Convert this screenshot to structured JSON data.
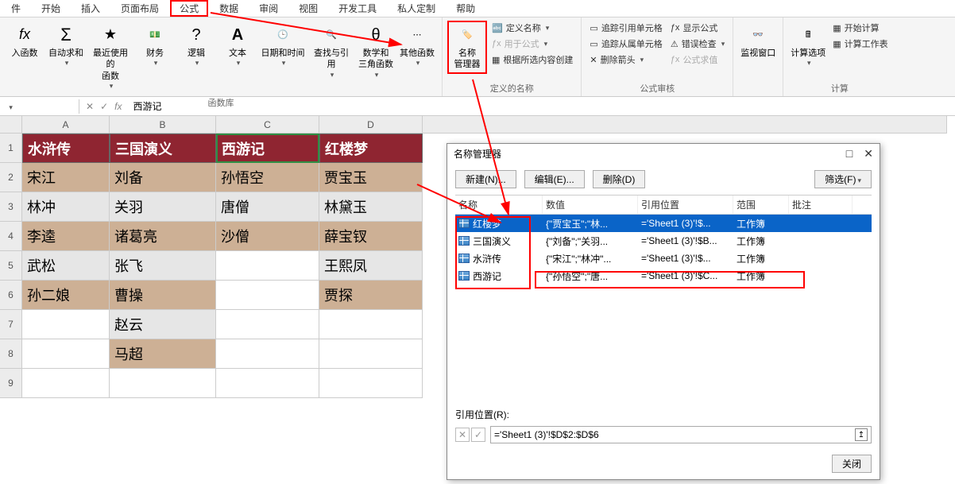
{
  "ribbon": {
    "tabs": [
      "件",
      "开始",
      "插入",
      "页面布局",
      "公式",
      "数据",
      "审阅",
      "视图",
      "开发工具",
      "私人定制",
      "帮助"
    ],
    "active_tab_index": 4,
    "group1": {
      "fx_label": "入函数",
      "autosum": "自动求和",
      "recent": "最近使用的\n函数",
      "financial": "财务",
      "logical": "逻辑",
      "text": "文本",
      "datetime": "日期和时间",
      "lookup": "查找与引用",
      "math": "数学和\n三角函数",
      "more": "其他函数",
      "label": "函数库"
    },
    "group2": {
      "name_mgr": "名称\n管理器",
      "define_name": "定义名称",
      "use_in_formula": "用于公式",
      "create_from_sel": "根据所选内容创建",
      "label": "定义的名称"
    },
    "group3": {
      "trace_prec": "追踪引用单元格",
      "trace_dep": "追踪从属单元格",
      "remove_arrows": "删除箭头",
      "show_formulas": "显示公式",
      "error_check": "错误检查",
      "eval_formula": "公式求值",
      "label": "公式审核"
    },
    "group4": {
      "watch": "监视窗口"
    },
    "group5": {
      "calc_opts": "计算选项",
      "calc_now": "开始计算",
      "calc_sheet": "计算工作表",
      "label": "计算"
    }
  },
  "formula_bar": {
    "name_box": "",
    "fx_value": "西游记"
  },
  "sheet": {
    "col_headers": [
      "A",
      "B",
      "C",
      "D"
    ],
    "row_headers": [
      "1",
      "2",
      "3",
      "4",
      "5",
      "6",
      "7",
      "8",
      "9"
    ],
    "headers": [
      "水浒传",
      "三国演义",
      "西游记",
      "红楼梦"
    ],
    "cols": {
      "A": [
        "宋江",
        "林冲",
        "李逵",
        "武松",
        "孙二娘"
      ],
      "B": [
        "刘备",
        "关羽",
        "诸葛亮",
        "张飞",
        "曹操",
        "赵云",
        "马超"
      ],
      "C": [
        "孙悟空",
        "唐僧",
        "沙僧"
      ],
      "D": [
        "贾宝玉",
        "林黛玉",
        "薛宝钗",
        "王熙凤",
        "贾探"
      ]
    }
  },
  "name_manager": {
    "title": "名称管理器",
    "new_btn": "新建(N)...",
    "edit_btn": "编辑(E)...",
    "delete_btn": "删除(D)",
    "filter_btn": "筛选(F)",
    "col_name": "名称",
    "col_value": "数值",
    "col_ref": "引用位置",
    "col_scope": "范围",
    "col_note": "批注",
    "rows": [
      {
        "name": "红楼梦",
        "value": "{\"贾宝玉\";\"林...",
        "ref": "='Sheet1 (3)'!$...",
        "scope": "工作簿"
      },
      {
        "name": "三国演义",
        "value": "{\"刘备\";\"关羽...",
        "ref": "='Sheet1 (3)'!$B...",
        "scope": "工作簿"
      },
      {
        "name": "水浒传",
        "value": "{\"宋江\";\"林冲\"...",
        "ref": "='Sheet1 (3)'!$...",
        "scope": "工作簿"
      },
      {
        "name": "西游记",
        "value": "{\"孙悟空\";\"唐...",
        "ref": "='Sheet1 (3)'!$C...",
        "scope": "工作簿"
      }
    ],
    "selected_index": 0,
    "ref_label": "引用位置(R):",
    "ref_value": "='Sheet1 (3)'!$D$2:$D$6",
    "close_btn": "关闭"
  }
}
